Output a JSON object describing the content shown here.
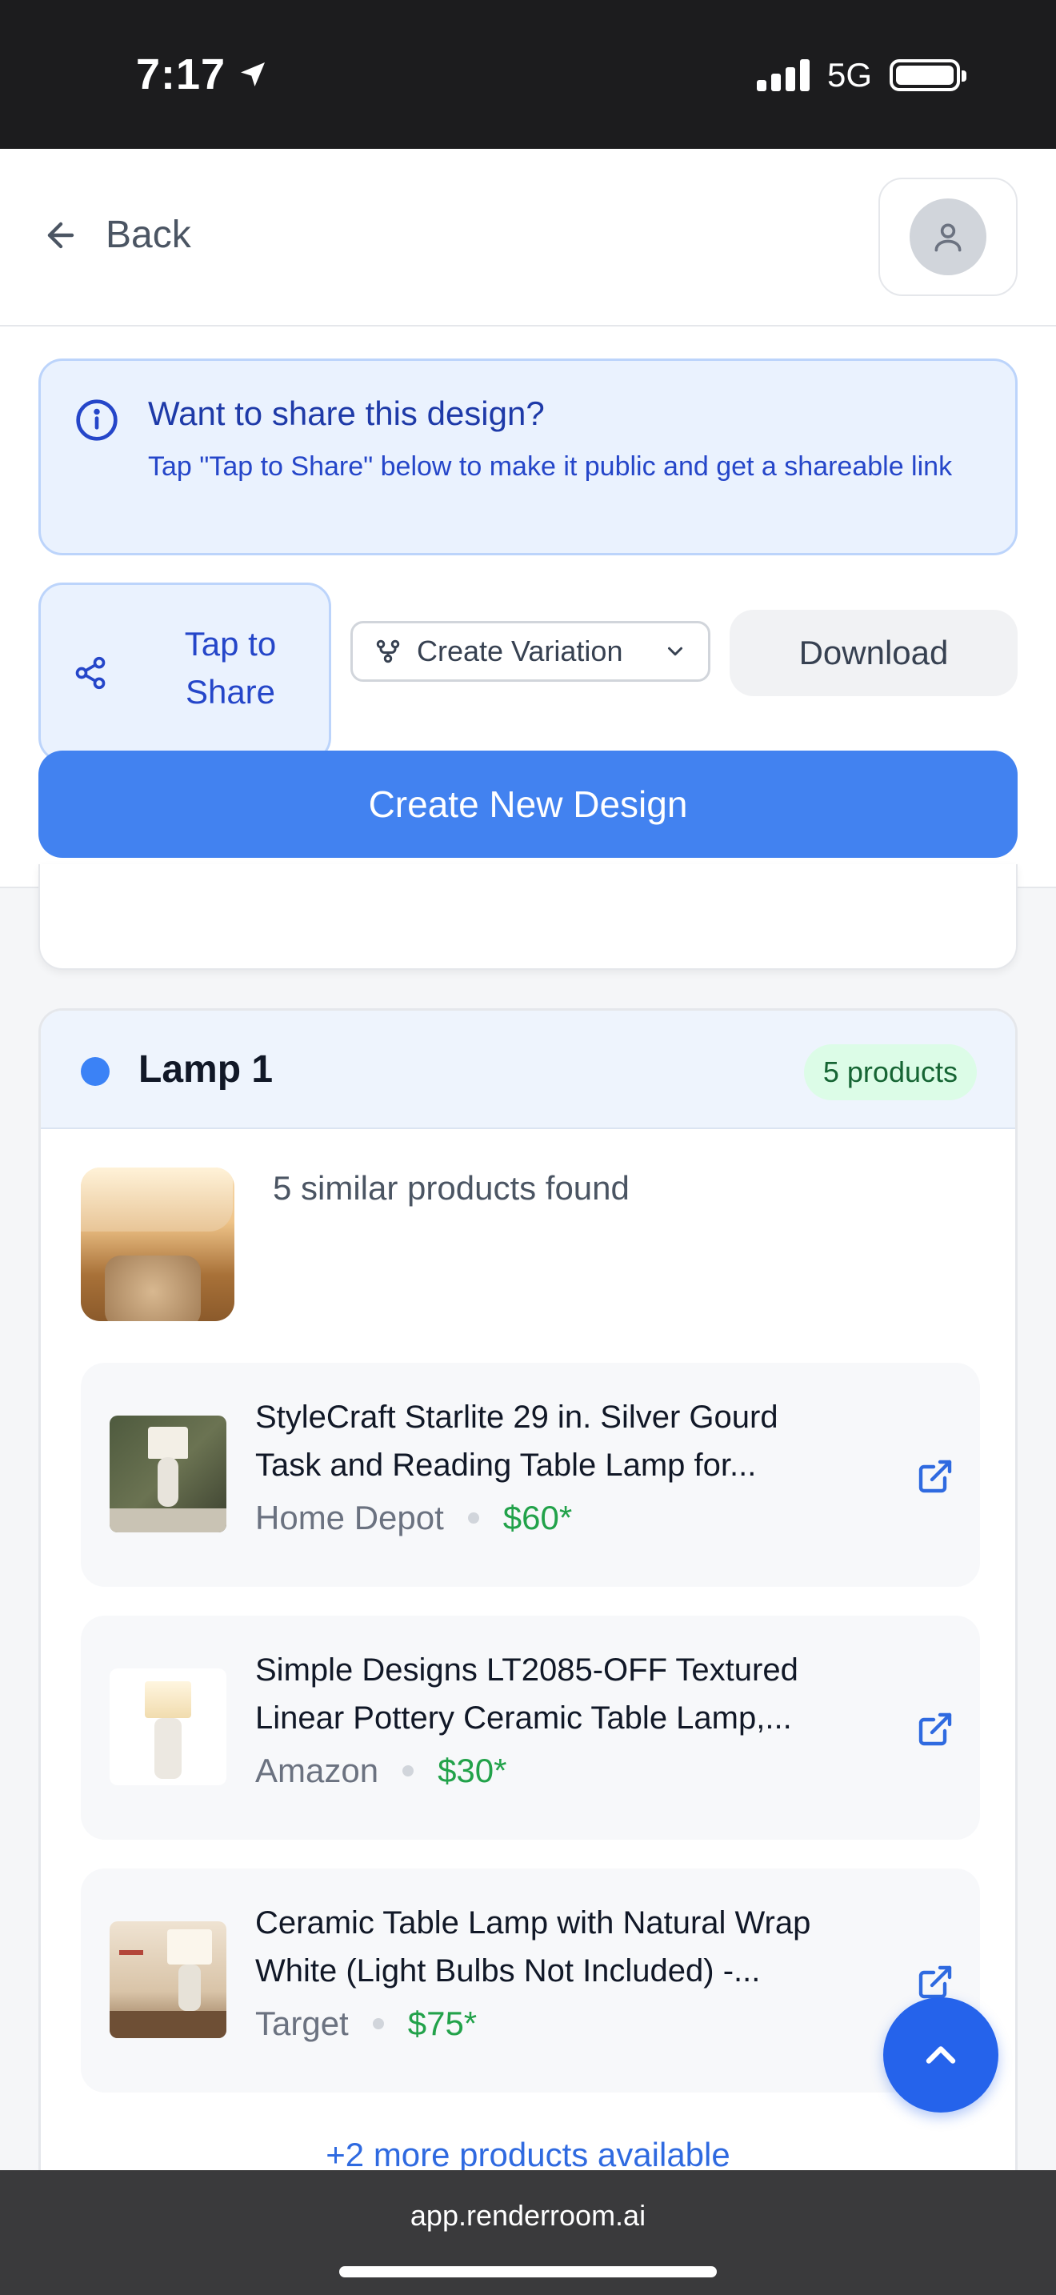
{
  "status_bar": {
    "time": "7:17",
    "network": "5G"
  },
  "header": {
    "back_label": "Back"
  },
  "share_notice": {
    "title": "Want to share this design?",
    "text": "Tap \"Tap to Share\" below to make it public and get a shareable link"
  },
  "actions": {
    "share_line1": "Tap to",
    "share_line2": "Share",
    "variation_label": "Create Variation",
    "download_label": "Download",
    "create_label": "Create New Design"
  },
  "lamp_group": {
    "title": "Lamp 1",
    "badge": "5 products",
    "similar_text": "5 similar products found",
    "more_link": "+2 more products available",
    "products": [
      {
        "title_line1": "StyleCraft Starlite 29 in. Silver Gourd",
        "title_line2": "Task and Reading Table Lamp for...",
        "store": "Home Depot",
        "price": "$60*"
      },
      {
        "title_line1": "Simple Designs LT2085-OFF Textured",
        "title_line2": "Linear Pottery Ceramic Table Lamp,...",
        "store": "Amazon",
        "price": "$30*"
      },
      {
        "title_line1": "Ceramic Table Lamp with Natural Wrap",
        "title_line2": "White (Light Bulbs Not Included) -...",
        "store": "Target",
        "price": "$75*"
      }
    ]
  },
  "browser": {
    "url": "app.renderroom.ai"
  },
  "colors": {
    "primary": "#4282f0",
    "price": "#22a24a",
    "info_bg": "#eaf2fe"
  }
}
